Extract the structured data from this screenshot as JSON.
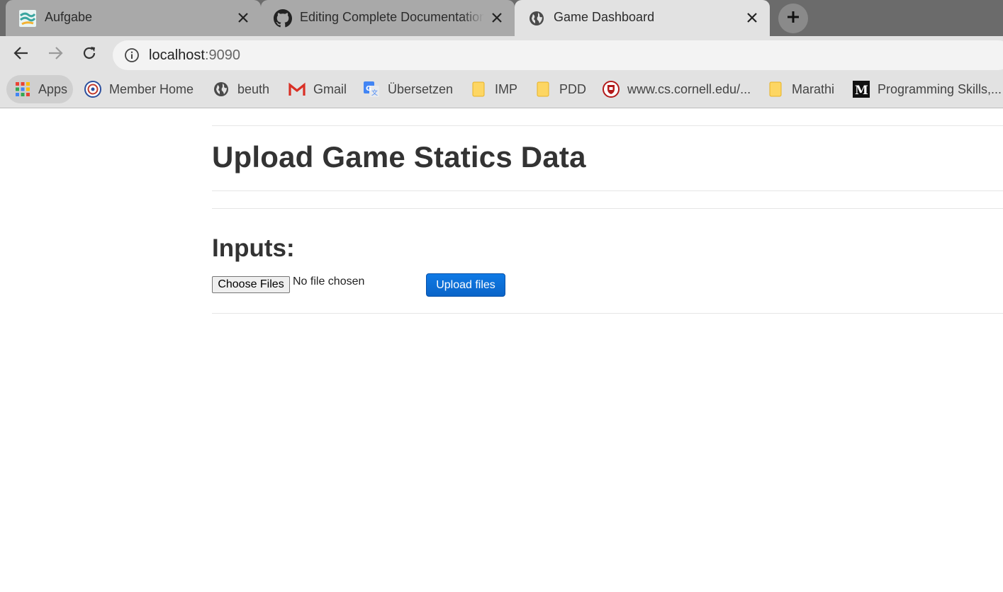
{
  "browser": {
    "tabs": [
      {
        "title": "Aufgabe",
        "icon": "aufgabe-logo-icon",
        "active": false
      },
      {
        "title": "Editing Complete Documentation",
        "icon": "github-icon",
        "active": false
      },
      {
        "title": "Game Dashboard",
        "icon": "globe-icon",
        "active": true
      }
    ],
    "url": {
      "host": "localhost",
      "port": ":9090"
    },
    "bookmarks": [
      {
        "label": "Apps",
        "icon": "apps-grid-icon"
      },
      {
        "label": "Member Home",
        "icon": "emblem-icon"
      },
      {
        "label": "beuth",
        "icon": "globe-icon"
      },
      {
        "label": "Gmail",
        "icon": "gmail-icon"
      },
      {
        "label": "Übersetzen",
        "icon": "google-translate-icon"
      },
      {
        "label": "IMP",
        "icon": "folder-icon"
      },
      {
        "label": "PDD",
        "icon": "folder-icon"
      },
      {
        "label": "www.cs.cornell.edu/...",
        "icon": "cornell-shield-icon"
      },
      {
        "label": "Marathi",
        "icon": "folder-icon"
      },
      {
        "label": "Programming Skills,...",
        "icon": "medium-icon"
      }
    ]
  },
  "page": {
    "title": "Upload Game Statics Data",
    "section_title": "Inputs:",
    "file_input": {
      "button_label": "Choose Files",
      "status": "No file chosen"
    },
    "upload_button_label": "Upload files"
  },
  "colors": {
    "accent": "#0a6fd6",
    "heading": "#333333",
    "tab_strip": "#6b6b6b",
    "toolbar": "#e2e2e2"
  }
}
